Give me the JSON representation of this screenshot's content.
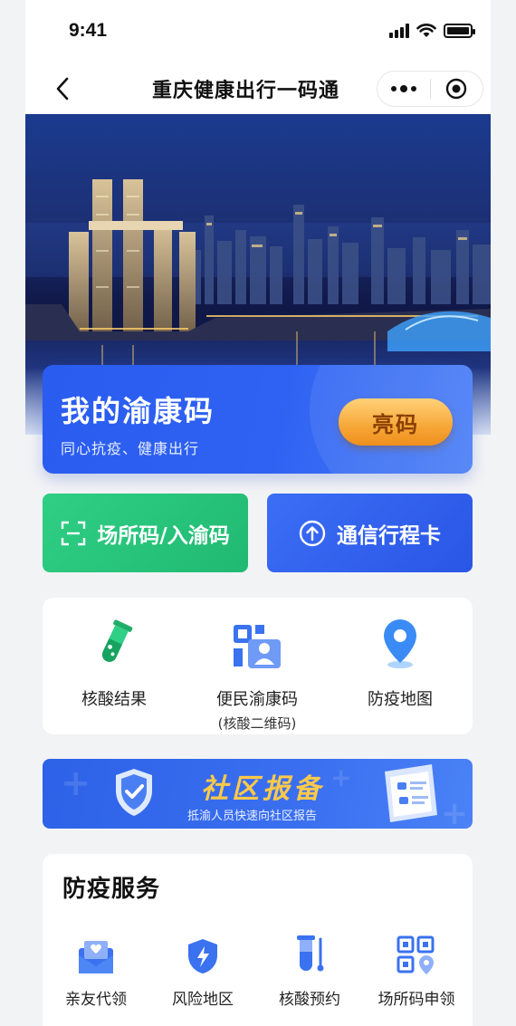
{
  "status_bar": {
    "time": "9:41"
  },
  "nav": {
    "title": "重庆健康出行一码通"
  },
  "health_code": {
    "title": "我的渝康码",
    "subtitle": "同心抗疫、健康出行",
    "show_button": "亮码"
  },
  "actions": [
    {
      "label": "场所码/入渝码",
      "icon": "scan-icon",
      "color": "#27c27b"
    },
    {
      "label": "通信行程卡",
      "icon": "arrow-up-circle-icon",
      "color": "#3262ef"
    }
  ],
  "quick_links": [
    {
      "label": "核酸结果",
      "sub": "",
      "icon": "test-tube-icon"
    },
    {
      "label": "便民渝康码",
      "sub": "(核酸二维码)",
      "icon": "id-card-qr-icon"
    },
    {
      "label": "防疫地图",
      "sub": "",
      "icon": "map-pin-icon"
    }
  ],
  "community_banner": {
    "title": "社区报备",
    "subtitle": "抵渝人员快速向社区报告"
  },
  "services": {
    "title": "防疫服务",
    "items": [
      {
        "label": "亲友代领",
        "icon": "envelope-heart-icon"
      },
      {
        "label": "风险地区",
        "icon": "shield-bolt-icon"
      },
      {
        "label": "核酸预约",
        "icon": "test-tube-icon"
      },
      {
        "label": "场所码申领",
        "icon": "qr-code-icon"
      }
    ]
  },
  "colors": {
    "primary_blue": "#2f62f2",
    "green": "#27c27b",
    "orange": "#f6a737",
    "background": "#f2f3f5"
  }
}
